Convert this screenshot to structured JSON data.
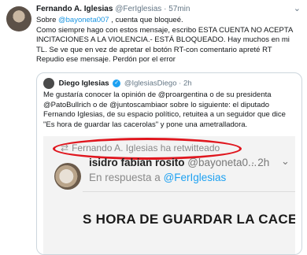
{
  "tweet": {
    "author_name": "Fernando A. Iglesias",
    "author_handle": "@FerIglesias",
    "separator": "·",
    "time": "57min",
    "text_prefix": "Sobre ",
    "text_mention": "@bayoneta007",
    "text_suffix": " , cuenta que bloqueé.",
    "text_body": "Como siempre hago con estos mensaje, escribo ESTA CUENTA NO ACEPTA INCITACIONES A LA VIOLENCIA.- ESTÁ BLOQUEADO. Hay muchos en mi TL. Se ve que en vez de apretar el botón RT-con comentario apreté RT Repudio ese mensaje. Perdón por el error"
  },
  "quoted": {
    "author_name": "Diego Iglesias",
    "author_handle": "@IglesiasDiego",
    "separator": "·",
    "time": "2h",
    "text": "Me gustaría conocer la opinión de @proargentina o de su presidenta @PatoBullrich o de @juntoscambiaor sobre lo siguiente: el diputado Fernando Iglesias, de su espacio político, retuitea a un seguidor que dice \"Es hora de guardar las cacerolas\" y pone una ametralladora."
  },
  "embedded": {
    "retweeted_line": "Fernando A. Iglesias ha retwitteado",
    "author_name": "isidro fabian rosito",
    "author_handle": "@bayoneta0...",
    "time": "· 2h",
    "reply_prefix": "En respuesta a ",
    "reply_mention": "@FerIglesias",
    "headline": "S HORA DE GUARDAR LA CACEROLAS"
  },
  "colors": {
    "accent": "#1da1f2",
    "highlight_circle": "#e0161e"
  },
  "icons": {
    "retweet": "retweet-icon",
    "verified": "verified-icon",
    "chevron": "chevron-down-icon"
  }
}
